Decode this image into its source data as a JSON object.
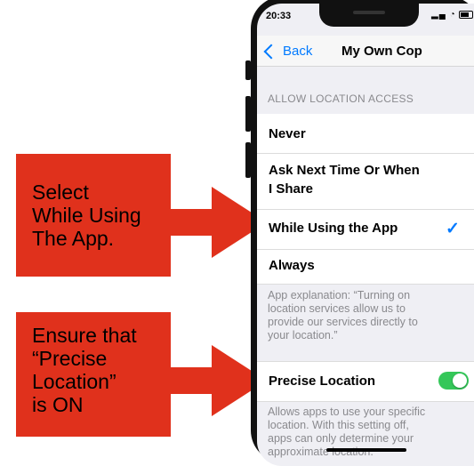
{
  "colors": {
    "callout_red": "#e0311c",
    "ios_blue": "#007aff",
    "toggle_green": "#34c759"
  },
  "callouts": [
    {
      "lines": [
        "Select",
        "While Using",
        "The App."
      ]
    },
    {
      "lines": [
        "Ensure that",
        "“Precise",
        "Location”",
        "is ON"
      ]
    }
  ],
  "status_bar": {
    "time": "20:33",
    "signal_icon": "signal-icon",
    "wifi_icon": "wifi-icon",
    "battery_icon": "battery-icon"
  },
  "navbar": {
    "back_label": "Back",
    "title": "My Own Cop"
  },
  "location_section": {
    "header": "ALLOW LOCATION ACCESS",
    "options": [
      {
        "label": "Never",
        "selected": false
      },
      {
        "label_lines": [
          "Ask Next Time Or When",
          "I Share"
        ],
        "selected": false
      },
      {
        "label": "While Using the App",
        "selected": true
      },
      {
        "label": "Always",
        "selected": false
      }
    ],
    "explanation_lines": [
      "App explanation: “Turning on",
      "location services allow us to",
      "provide our services directly to",
      "your location.”"
    ]
  },
  "precise_location": {
    "label": "Precise Location",
    "enabled": true,
    "footer_lines": [
      "Allows apps to use your specific",
      "location. With this setting off,",
      "apps can only determine your",
      "approximate location."
    ]
  }
}
